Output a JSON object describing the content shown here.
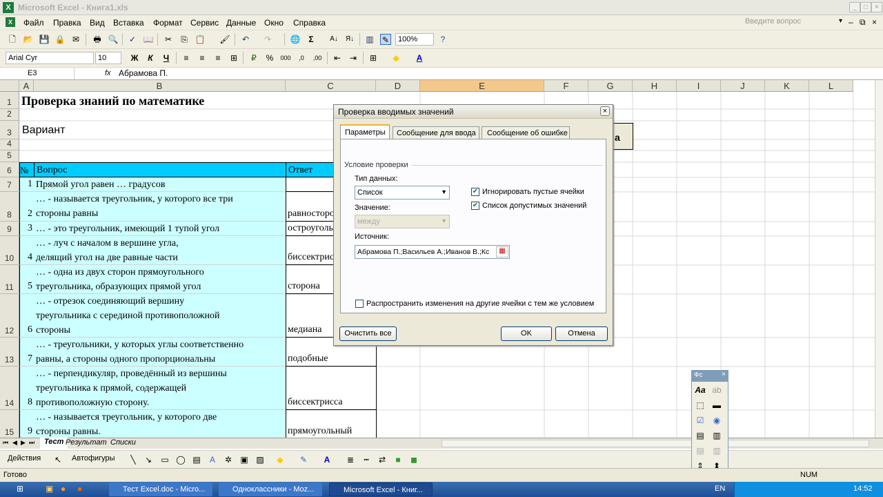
{
  "window": {
    "title": "Microsoft Excel - Книга1.xls"
  },
  "menu": [
    "Файл",
    "Правка",
    "Вид",
    "Вставка",
    "Формат",
    "Сервис",
    "Данные",
    "Окно",
    "Справка"
  ],
  "ask_placeholder": "Введите вопрос",
  "toolbar": {
    "zoom": "100%",
    "font": "Arial Cyr",
    "font_size": "10"
  },
  "formula_bar": {
    "name_box": "E3",
    "fx": "fx",
    "value": "Абрамова П."
  },
  "columns": [
    "A",
    "B",
    "C",
    "D",
    "E",
    "F",
    "G",
    "H",
    "I",
    "J",
    "K",
    "L"
  ],
  "rows": [
    "1",
    "2",
    "3",
    "4",
    "5",
    "6",
    "7",
    "8",
    "9",
    "10",
    "11",
    "12",
    "13",
    "14",
    "15"
  ],
  "sheet": {
    "title": "Проверка знаний по математике",
    "variant": "Вариант",
    "header_num": "№",
    "header_question": "Вопрос",
    "header_answer": "Ответ",
    "button_fragment": "а",
    "items": [
      {
        "n": "1",
        "lines": [
          "Прямой угол равен … градусов"
        ],
        "answer": ""
      },
      {
        "n": "2",
        "lines": [
          "… - называется треугольник, у которого все три",
          "стороны равны"
        ],
        "answer": "равносторонний"
      },
      {
        "n": "3",
        "lines": [
          "… - это треугольник, имеющий 1 тупой угол"
        ],
        "answer": "остроугольный"
      },
      {
        "n": "4",
        "lines": [
          "… - луч с началом в вершине угла,",
          "делящий угол на две равные части"
        ],
        "answer": "биссектриса"
      },
      {
        "n": "5",
        "lines": [
          "… - одна из двух сторон прямоугольного",
          "треугольника, образующих прямой угол"
        ],
        "answer": "сторона"
      },
      {
        "n": "6",
        "lines": [
          "… - отрезок соединяющий вершину",
          "треугольника с серединой противоположной",
          "стороны"
        ],
        "answer": "медиана"
      },
      {
        "n": "7",
        "lines": [
          "… - треугольники, у которых углы соответственно",
          "равны, а стороны одного пропорциональны"
        ],
        "answer": "подобные"
      },
      {
        "n": "8",
        "lines": [
          "… - перпендикуляр, проведённый из вершины",
          "треугольника к прямой, содержащей",
          "противоположную сторону."
        ],
        "answer": "биссектрисса"
      },
      {
        "n": "9",
        "lines": [
          "… - называется треугольник, у которого две",
          "стороны равны."
        ],
        "answer": "прямоугольный"
      }
    ]
  },
  "dialog": {
    "title": "Проверка вводимых значений",
    "tabs": [
      "Параметры",
      "Сообщение для ввода",
      "Сообщение об ошибке"
    ],
    "group": "Условие проверки",
    "type_label": "Тип данных:",
    "type_value": "Список",
    "value_label": "Значение:",
    "value_value": "между",
    "ignore_blank": "Игнорировать пустые ячейки",
    "in_cell_dropdown": "Список допустимых значений",
    "source_label": "Источник:",
    "source_value": "Абрамова П.;Васильев А.;Иванов В.;Кс",
    "apply_all": "Распространить изменения на другие ячейки с тем же условием",
    "clear_all": "Очистить все",
    "ok": "OK",
    "cancel": "Отмена"
  },
  "sheet_tabs": [
    "Тест",
    "Результат",
    "Списки"
  ],
  "draw_toolbar": {
    "actions": "Действия",
    "autoshapes": "Автофигуры"
  },
  "forms_toolbar_title": "Фс",
  "status": {
    "ready": "Готово",
    "num": "NUM"
  },
  "taskbar": {
    "tasks": [
      "Тест Excel.doc - Micro...",
      "Одноклассники - Moz...",
      "Microsoft Excel - Книг..."
    ],
    "lang": "EN",
    "clock": "14:52"
  }
}
